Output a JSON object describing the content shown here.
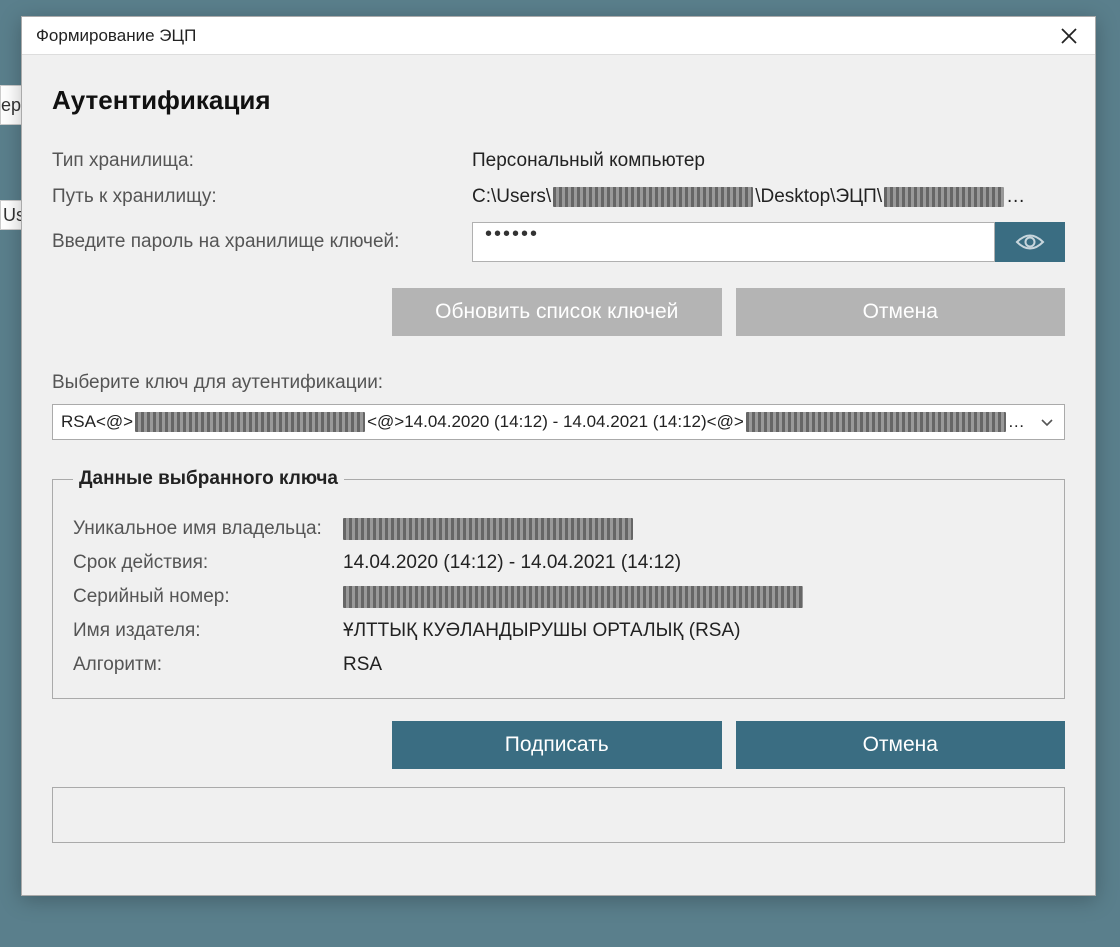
{
  "bg": {
    "partial1": "Us",
    "partial2": "ер"
  },
  "modal": {
    "title": "Формирование ЭЦП",
    "heading": "Аутентификация",
    "storage_type_label": "Тип хранилища:",
    "storage_type_value": "Персональный компьютер",
    "path_label": "Путь к хранилищу:",
    "path_prefix": "C:\\Users\\",
    "path_mid": "\\Desktop\\ЭЦП\\",
    "path_suffix": "…",
    "password_label": "Введите пароль на хранилище ключей:",
    "password_value": "••••••",
    "refresh_btn": "Обновить список ключей",
    "cancel_btn": "Отмена",
    "select_key_label": "Выберите ключ для аутентификации:",
    "key_option_p1": "RSA<@>",
    "key_option_p2": "<@>14.04.2020 (14:12) - 14.04.2021 (14:12)<@>",
    "key_option_suffix": "…",
    "keydata": {
      "legend": "Данные выбранного ключа",
      "owner_label": "Уникальное имя владельца:",
      "validity_label": "Срок действия:",
      "validity_value": "14.04.2020 (14:12) - 14.04.2021 (14:12)",
      "serial_label": "Серийный номер:",
      "issuer_label": "Имя издателя:",
      "issuer_value": "ҰЛТТЫҚ КУӘЛАНДЫРУШЫ ОРТАЛЫҚ (RSA)",
      "algo_label": "Алгоритм:",
      "algo_value": "RSA"
    },
    "sign_btn": "Подписать",
    "cancel2_btn": "Отмена"
  }
}
